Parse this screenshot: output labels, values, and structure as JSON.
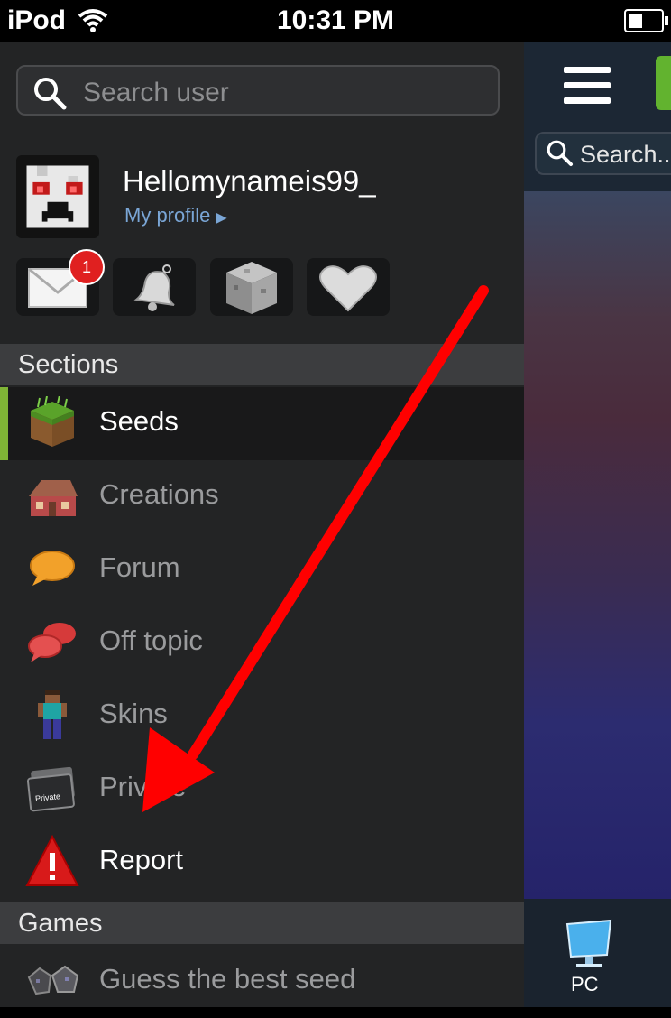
{
  "status_bar": {
    "carrier": "iPod",
    "time": "10:31 PM",
    "battery_level": 0.45
  },
  "search": {
    "placeholder": "Search user"
  },
  "profile": {
    "username": "Hellomynameis99_",
    "link": "My profile"
  },
  "quick_actions": [
    {
      "name": "messages",
      "icon": "envelope-icon",
      "badge": "1"
    },
    {
      "name": "notifications",
      "icon": "bell-icon"
    },
    {
      "name": "blocks",
      "icon": "stone-block-icon"
    },
    {
      "name": "favorites",
      "icon": "heart-icon"
    }
  ],
  "sections": {
    "header": "Sections",
    "items": [
      {
        "label": "Seeds",
        "icon": "grass-block-icon",
        "active": true
      },
      {
        "label": "Creations",
        "icon": "house-icon"
      },
      {
        "label": "Forum",
        "icon": "speech-bubble-icon"
      },
      {
        "label": "Off topic",
        "icon": "speech-bubbles-icon"
      },
      {
        "label": "Skins",
        "icon": "character-skin-icon"
      },
      {
        "label": "Private",
        "icon": "private-folder-icon"
      },
      {
        "label": "Report",
        "icon": "warning-triangle-icon"
      }
    ]
  },
  "games": {
    "header": "Games",
    "items": [
      {
        "label": "Guess the best seed",
        "icon": "ore-blocks-icon"
      }
    ]
  },
  "main_view": {
    "search_label": "Search..",
    "bottom_tab": {
      "label": "PC",
      "icon": "monitor-icon"
    }
  },
  "colors": {
    "active_accent": "#7fb436",
    "annotation_arrow": "#ff0000",
    "link": "#7aa6d6"
  }
}
